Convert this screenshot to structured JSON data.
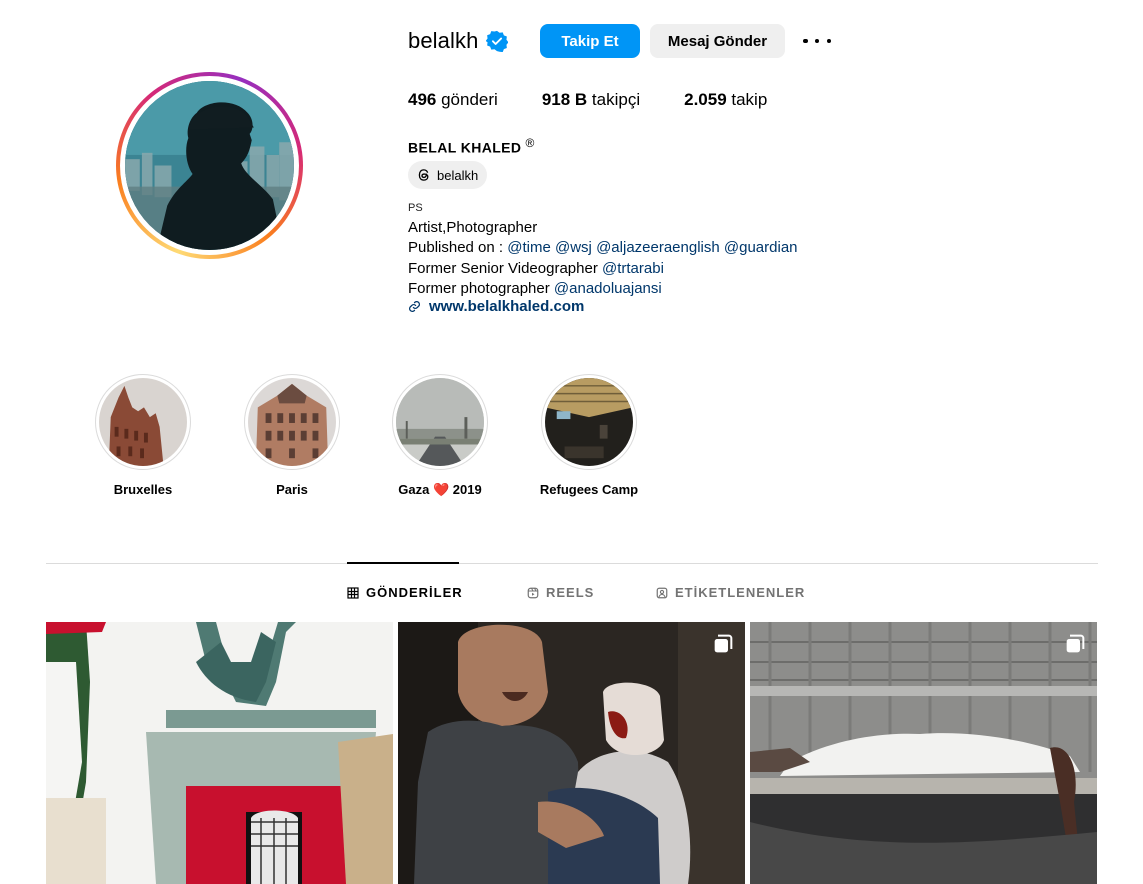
{
  "profile": {
    "username": "belalkh",
    "follow_label": "Takip Et",
    "message_label": "Mesaj Gönder",
    "stats": [
      {
        "count": "496",
        "label": " gönderi"
      },
      {
        "count": "918 B",
        "label": " takipçi"
      },
      {
        "count": "2.059",
        "label": " takip"
      }
    ],
    "full_name": "BELAL KHALED",
    "full_name_mark": "®",
    "threads_handle": "belalkh",
    "category": "PS",
    "bio_line1": "Artist,Photographer",
    "bio_line2_prefix": "Published on : ",
    "bio_line2_mentions": [
      "@time",
      "@wsj",
      "@aljazeeraenglish",
      "@guardian"
    ],
    "bio_line3_prefix": "Former Senior Videographer ",
    "bio_line3_mention": "@trtarabi",
    "bio_line4_prefix": "Former photographer ",
    "bio_line4_mention": "@anadoluajansi",
    "website": "www.belalkhaled.com"
  },
  "highlights": [
    {
      "label": "Bruxelles"
    },
    {
      "label": "Paris"
    },
    {
      "label_prefix": "Gaza ",
      "heart": "❤️",
      "label_suffix": " 2019"
    },
    {
      "label": "Refugees Camp"
    }
  ],
  "tabs": [
    {
      "label": "GÖNDERİLER",
      "icon": "grid-icon",
      "active": true
    },
    {
      "label": "REELS",
      "icon": "reels-icon",
      "active": false
    },
    {
      "label": "ETİKETLENENLER",
      "icon": "tagged-icon",
      "active": false
    }
  ],
  "colors": {
    "accent": "#0095f6",
    "link": "#00376b",
    "secondary_button": "#efefef",
    "muted_text": "#737373",
    "divider": "#dbdbdb",
    "heart": "#e0245e"
  }
}
